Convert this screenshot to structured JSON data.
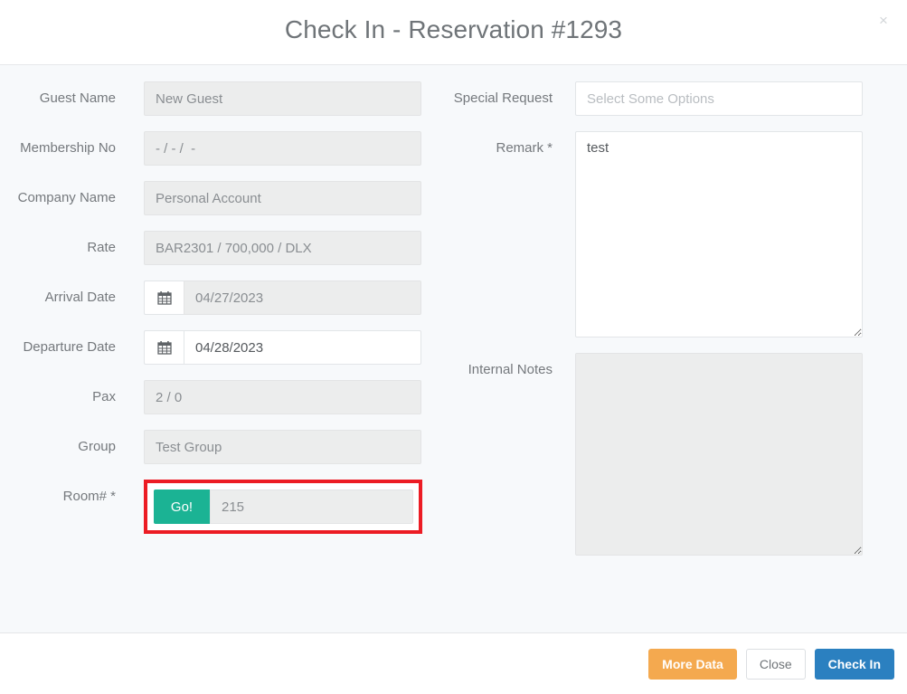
{
  "header": {
    "title": "Check In - Reservation #1293",
    "close_icon": "close-icon",
    "close_label": "×"
  },
  "form": {
    "left": [
      {
        "label": "Guest Name",
        "value": "New Guest",
        "state": "disabled",
        "type": "text"
      },
      {
        "label": "Membership No",
        "value": "- / - /  -",
        "state": "disabled",
        "type": "text"
      },
      {
        "label": "Company Name",
        "value": "Personal Account",
        "state": "disabled",
        "type": "text"
      },
      {
        "label": "Rate",
        "value": "BAR2301 / 700,000 / DLX",
        "state": "disabled",
        "type": "text"
      },
      {
        "label": "Arrival Date",
        "value": "04/27/2023",
        "state": "disabled",
        "type": "date",
        "icon": "calendar-icon"
      },
      {
        "label": "Departure Date",
        "value": "04/28/2023",
        "state": "enabled",
        "type": "date",
        "icon": "calendar-icon"
      },
      {
        "label": "Pax",
        "value": "2 / 0",
        "state": "disabled",
        "type": "text"
      },
      {
        "label": "Group",
        "value": "Test Group",
        "state": "disabled",
        "type": "text"
      },
      {
        "label": "Room# *",
        "value": "215",
        "state": "disabled",
        "type": "room",
        "button_label": "Go!",
        "highlighted": true
      }
    ],
    "right": {
      "special_request": {
        "label": "Special Request",
        "value": "",
        "placeholder": "Select Some Options",
        "state": "enabled"
      },
      "remark": {
        "label": "Remark *",
        "value": "test",
        "placeholder": "",
        "state": "enabled"
      },
      "internal_notes": {
        "label": "Internal Notes",
        "value": "",
        "placeholder": "",
        "state": "disabled"
      }
    }
  },
  "footer": {
    "more_data_label": "More Data",
    "close_label": "Close",
    "check_in_label": "Check In"
  },
  "colors": {
    "go_button": "#1bb394",
    "highlight_box": "#ec1c24",
    "more_data": "#f4a94f",
    "check_in": "#2b80c0",
    "body_bg": "#f7f9fb"
  }
}
